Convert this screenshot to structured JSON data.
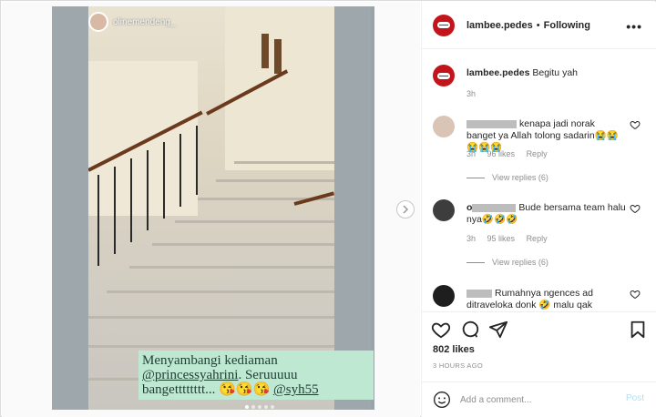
{
  "media": {
    "story_username": "olinemendeng_",
    "caption_line1": "Menyambangi kediaman",
    "caption_mention1": "@princessyahrini",
    "caption_line2": ". Seruuuuu",
    "caption_line3": "bangetttttttt... 😘😘😘 ",
    "caption_mention2": "@syh55"
  },
  "header": {
    "username": "lambee.pedes",
    "separator": "•",
    "follow_status": "Following",
    "more": "•••"
  },
  "comments": [
    {
      "username": "lambee.pedes",
      "text": "Begitu yah",
      "time": "3h"
    },
    {
      "text": "kenapa jadi norak banget ya Allah tolong sadarin😭😭😭😭😭",
      "time": "3h",
      "likes": "96 likes",
      "reply": "Reply",
      "view_replies": "View replies (6)"
    },
    {
      "username_partial": "o",
      "text": "Bude bersama team halu nya🤣🤣🤣",
      "time": "3h",
      "likes": "95 likes",
      "reply": "Reply",
      "view_replies": "View replies (6)"
    },
    {
      "text": "Rumahnya ngences ad ditraveloka donk 🤣 malu qak"
    }
  ],
  "post": {
    "likes": "802 likes",
    "time_ago": "3 HOURS AGO"
  },
  "composer": {
    "placeholder": "Add a comment...",
    "post_label": "Post"
  },
  "colors": {
    "brand_red": "#c3141c",
    "caption_bg": "#bfe8d3",
    "post_disabled": "#b2dffc"
  }
}
